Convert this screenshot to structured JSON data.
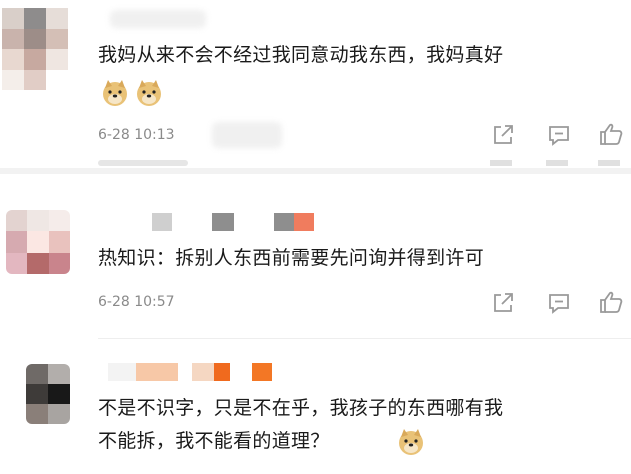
{
  "comments": [
    {
      "text_line1": "我妈从来不会不经过我同意动我东西，我妈真好",
      "emoji": [
        "doge-emoji",
        "doge-emoji"
      ],
      "time": "6-28 10:13"
    },
    {
      "text_line1": "热知识：拆别人东西前需要先问询并得到许可",
      "time": "6-28 10:57"
    },
    {
      "text_line1": "不是不识字，只是不在乎，我孩子的东西哪有我",
      "text_line2": "不能拆，我不能看的道理？",
      "emoji": [
        "doge-emoji"
      ]
    }
  ],
  "icons": [
    "share-icon",
    "comment-icon",
    "like-icon"
  ],
  "colors": {
    "text": "#1a1a1a",
    "time": "#8a8a8a",
    "icon": "#9a9a9a",
    "divider": "#eeeeee",
    "nick_orange": "#f07c2c"
  }
}
